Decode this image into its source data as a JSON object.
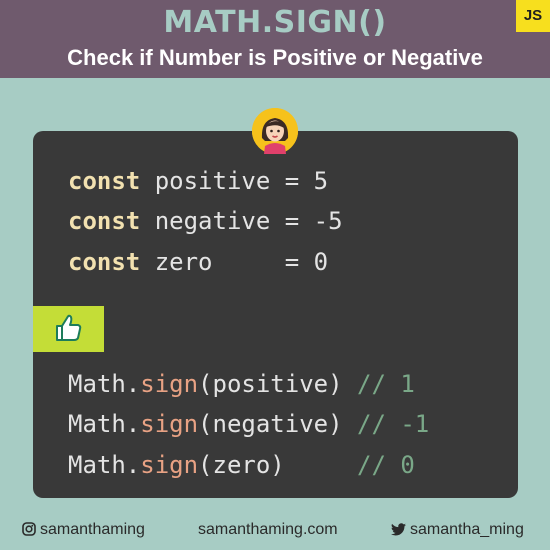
{
  "header": {
    "title": "MATH.SIGN()",
    "subtitle": "Check if Number is Positive or Negative",
    "badge": "JS"
  },
  "code": {
    "declarations": [
      {
        "keyword": "const",
        "name": "positive",
        "pad": " ",
        "op": "=",
        "value": "5"
      },
      {
        "keyword": "const",
        "name": "negative",
        "pad": " ",
        "op": "=",
        "value": "-5"
      },
      {
        "keyword": "const",
        "name": "zero",
        "pad": "     ",
        "op": "=",
        "value": "0"
      }
    ],
    "calls": [
      {
        "object": "Math.",
        "method": "sign",
        "arg": "(positive)",
        "pad": " ",
        "comment": "// 1"
      },
      {
        "object": "Math.",
        "method": "sign",
        "arg": "(negative)",
        "pad": " ",
        "comment": "// -1"
      },
      {
        "object": "Math.",
        "method": "sign",
        "arg": "(zero)",
        "pad": "     ",
        "comment": "// 0"
      }
    ]
  },
  "icons": {
    "avatar": "avatar-icon",
    "thumb": "thumbs-up-icon",
    "instagram": "instagram-icon",
    "twitter": "twitter-icon"
  },
  "footer": {
    "instagram": "samanthaming",
    "website": "samanthaming.com",
    "twitter": "samantha_ming"
  },
  "colors": {
    "background": "#a7ccc4",
    "header": "#6f5a6d",
    "code_bg": "#393939",
    "keyword": "#f2e1b0",
    "method": "#e8a284",
    "comment": "#7aa888",
    "accent": "#c4dd37",
    "badge": "#f7df1e"
  }
}
